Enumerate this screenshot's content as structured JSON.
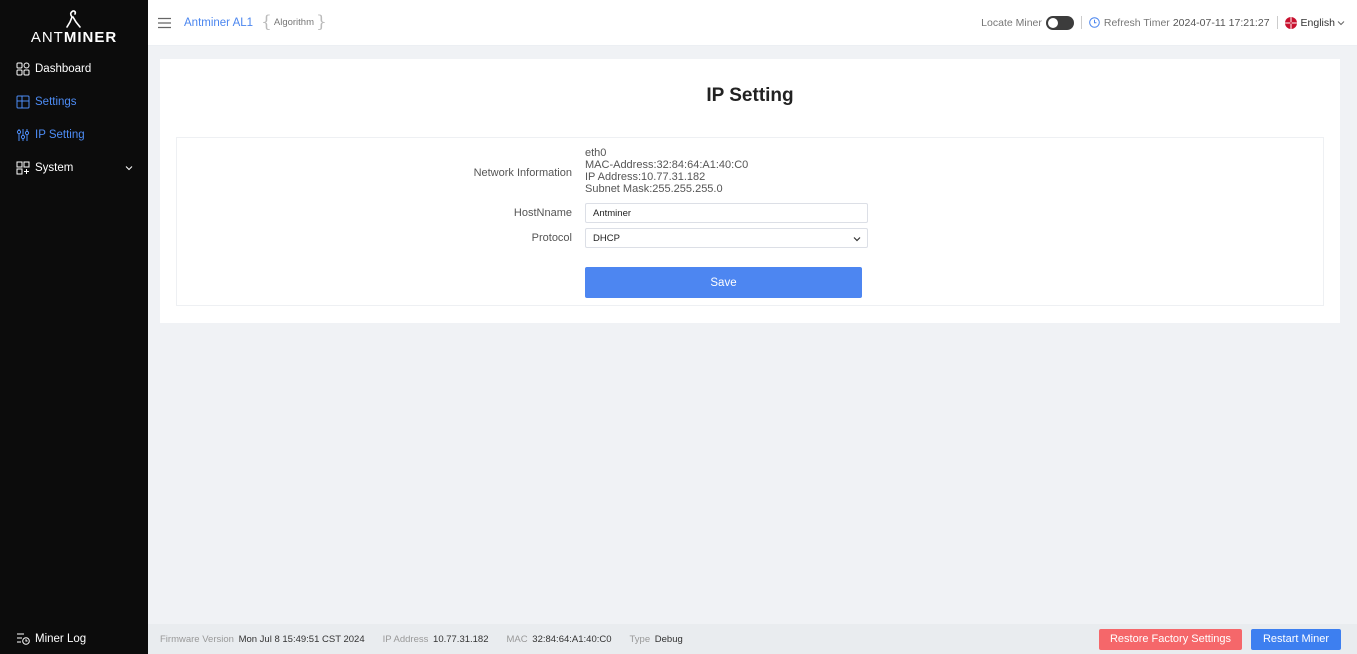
{
  "sidebar": {
    "logo": {
      "prefix": "ANT",
      "suffix": "MINER"
    },
    "items": [
      {
        "label": "Dashboard",
        "icon": "dashboard-icon"
      },
      {
        "label": "Settings",
        "icon": "settings-icon"
      },
      {
        "label": "IP Setting",
        "icon": "sliders-icon"
      },
      {
        "label": "System",
        "icon": "system-icon"
      }
    ],
    "miner_log": "Miner Log"
  },
  "header": {
    "breadcrumb": "Antminer AL1",
    "algorithm": "Algorithm",
    "locate_miner": "Locate Miner",
    "refresh_timer_label": "Refresh Timer",
    "refresh_timer_value": "2024-07-11 17:21:27",
    "language": "English"
  },
  "main": {
    "title": "IP Setting",
    "network_information_label": "Network Information",
    "network_information": {
      "iface": "eth0",
      "mac": "MAC-Address:32:84:64:A1:40:C0",
      "ip": "IP Address:10.77.31.182",
      "mask": "Subnet Mask:255.255.255.0"
    },
    "hostname_label": "HostNname",
    "hostname_value": "Antminer",
    "protocol_label": "Protocol",
    "protocol_value": "DHCP",
    "save_label": "Save"
  },
  "footer": {
    "firmware_label": "Firmware Version",
    "firmware_value": "Mon Jul 8 15:49:51 CST 2024",
    "ip_label": "IP Address",
    "ip_value": "10.77.31.182",
    "mac_label": "MAC",
    "mac_value": "32:84:64:A1:40:C0",
    "type_label": "Type",
    "type_value": "Debug",
    "restore_label": "Restore Factory Settings",
    "restart_label": "Restart Miner"
  },
  "colors": {
    "accent": "#4d86f1",
    "danger": "#f5676a",
    "sidebar_bg": "#0c0c0c"
  }
}
